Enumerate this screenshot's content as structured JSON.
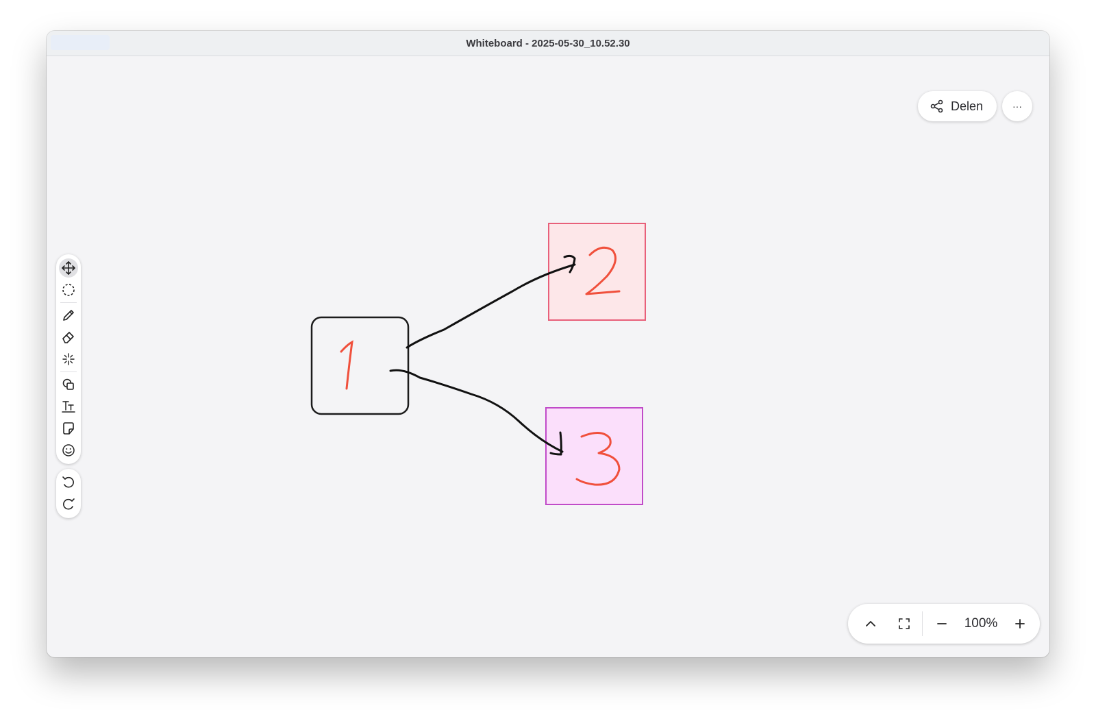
{
  "window": {
    "title": "Whiteboard - 2025-05-30_10.52.30"
  },
  "header": {
    "share_label": "Delen",
    "more_label": "···"
  },
  "toolbar": {
    "tools": [
      {
        "name": "move",
        "icon": "move-icon",
        "active": true
      },
      {
        "name": "lasso",
        "icon": "lasso-select-icon"
      },
      {
        "name": "pen",
        "icon": "pencil-icon"
      },
      {
        "name": "eraser",
        "icon": "eraser-icon"
      },
      {
        "name": "laser",
        "icon": "laser-pointer-icon"
      },
      {
        "name": "shapes",
        "icon": "shapes-icon"
      },
      {
        "name": "text",
        "icon": "text-icon"
      },
      {
        "name": "sticky-note",
        "icon": "sticky-note-icon"
      },
      {
        "name": "emoji",
        "icon": "emoji-icon"
      }
    ],
    "history": [
      {
        "name": "undo",
        "icon": "undo-icon"
      },
      {
        "name": "redo",
        "icon": "redo-icon"
      }
    ]
  },
  "canvas": {
    "nodes": [
      {
        "label": "1",
        "fill": "#f4f4f6",
        "stroke": "#1c1c1c",
        "text_color": "#f0503c"
      },
      {
        "label": "2",
        "fill": "#fde7e9",
        "stroke": "#e8607a",
        "text_color": "#f0503c"
      },
      {
        "label": "3",
        "fill": "#fbdffb",
        "stroke": "#c04bc8",
        "text_color": "#f0503c"
      }
    ]
  },
  "zoom": {
    "level": "100%",
    "collapse_icon": "chevron-up-icon",
    "fit_icon": "fit-screen-icon",
    "zoom_out_icon": "minus-icon",
    "zoom_in_icon": "plus-icon"
  }
}
